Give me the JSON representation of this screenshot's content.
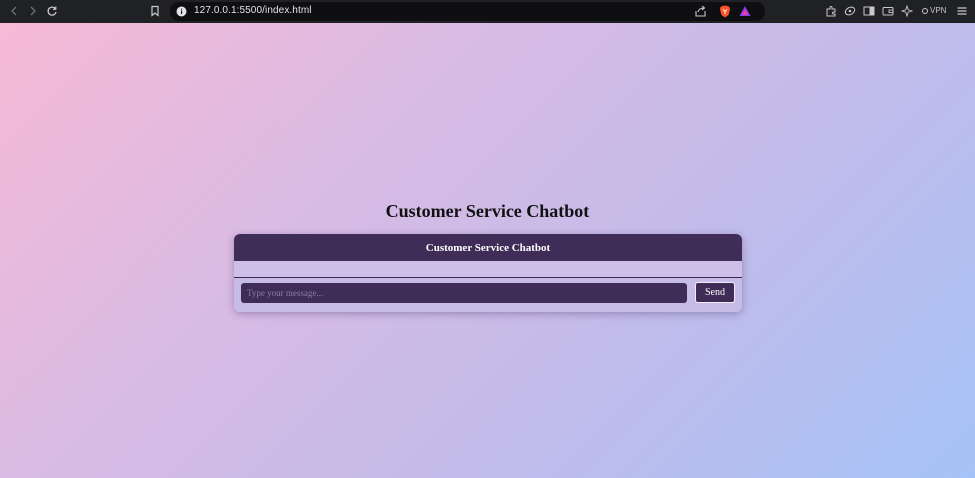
{
  "browser": {
    "url": "127.0.0.1:5500/index.html",
    "vpn_label": "VPN"
  },
  "page": {
    "title": "Customer Service Chatbot"
  },
  "chatbox": {
    "header": "Customer Service Chatbot",
    "input_placeholder": "Type your message...",
    "send_label": "Send"
  },
  "colors": {
    "accent": "#3f2c57",
    "gradient_start": "#f7b9d6",
    "gradient_end": "#a6c3f7"
  }
}
